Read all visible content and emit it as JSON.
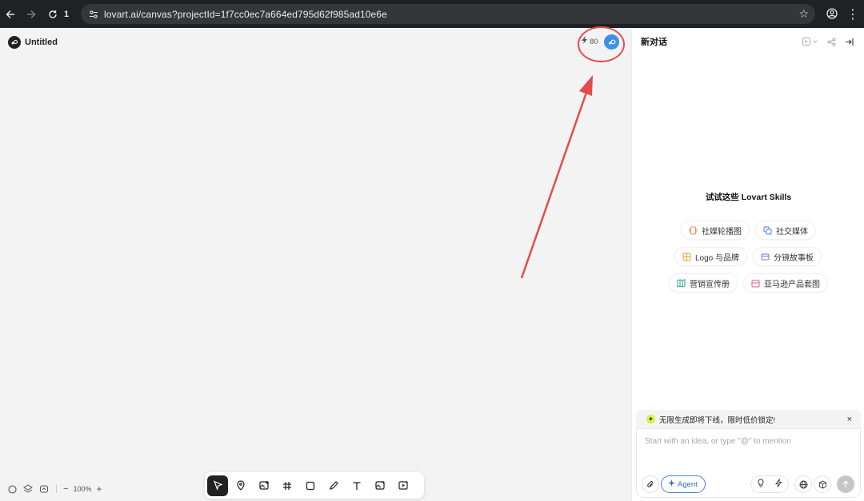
{
  "browser": {
    "tab_count": "1",
    "url": "lovart.ai/canvas?projectId=1f7cc0ec7a664ed795d62f985ad10e6e",
    "icons": [
      "back-arrow-icon",
      "forward-arrow-icon",
      "reload-icon",
      "site-info-icon",
      "star-icon",
      "profile-icon",
      "more-vert-icon"
    ]
  },
  "canvas": {
    "project_title": "Untitled",
    "credits": "80",
    "zoom": "100%",
    "zoom_minus": "−",
    "zoom_plus": "+",
    "annotation_color": "#e44c4c",
    "tools": [
      "select-cursor-icon",
      "pin-icon",
      "image-upload-icon",
      "frame-hash-icon",
      "rectangle-icon",
      "pen-icon",
      "text-icon",
      "image-generate-icon",
      "video-generate-icon"
    ]
  },
  "panel": {
    "title": "新对话",
    "skills_heading": "试试这些 Lovart Skills",
    "skills": [
      {
        "label": "社媒轮播图",
        "color": "#f08a5d"
      },
      {
        "label": "社交媒体",
        "color": "#4a7fe0"
      },
      {
        "label": "Logo 与品牌",
        "color": "#f0a030"
      },
      {
        "label": "分镜故事板",
        "color": "#8a6ae0"
      },
      {
        "label": "营销宣传册",
        "color": "#2aa88a"
      },
      {
        "label": "亚马逊产品套图",
        "color": "#e05a7a"
      }
    ],
    "promo_text": "无限生成即将下线，限时低价锁定!",
    "promo_close": "×",
    "input_placeholder": "Start with an idea, or type \"@\" to mention",
    "agent_label": "Agent",
    "accent_color": "#4a7fe0"
  }
}
